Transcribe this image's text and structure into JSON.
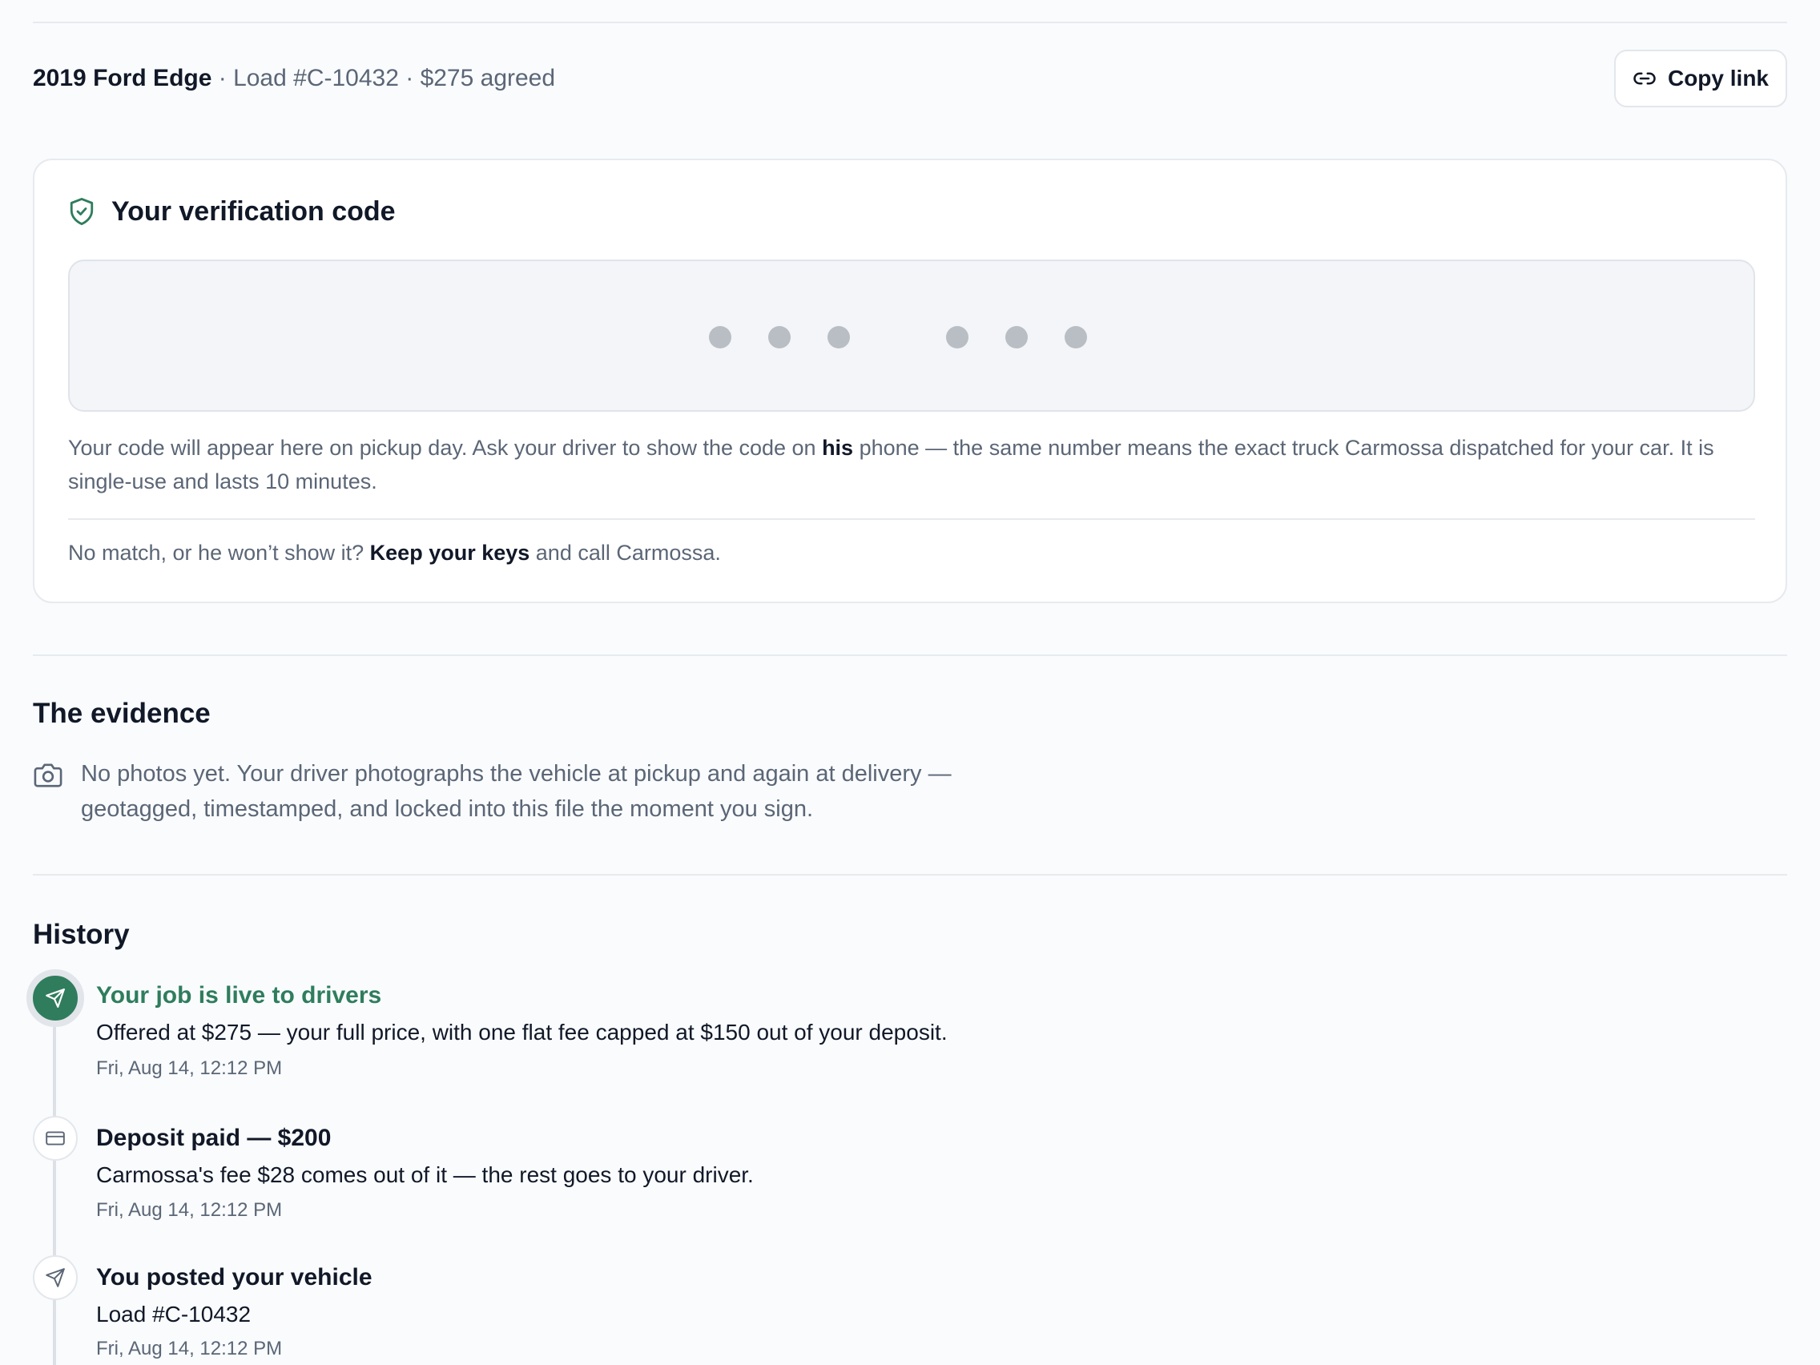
{
  "header": {
    "vehicle": "2019 Ford Edge",
    "meta": " · Load #C-10432 · $275 agreed",
    "copy_link_label": "Copy link"
  },
  "verification": {
    "title": "Your verification code",
    "code_placeholder_dots": 6,
    "desc_part1": "Your code will appear here on pickup day. Ask your driver to show the code on ",
    "desc_bold": "his",
    "desc_part2": " phone — the same number means the exact truck Carmossa dispatched for your car. It is single-use and lasts 10 minutes.",
    "warning_part1": "No match, or he won’t show it? ",
    "warning_bold": "Keep your keys",
    "warning_part2": " and call Carmossa."
  },
  "evidence": {
    "title": "The evidence",
    "text": "No photos yet. Your driver photographs the vehicle at pickup and again at delivery — geotagged, timestamped, and locked into this file the moment you sign."
  },
  "history": {
    "title": "History",
    "events": [
      {
        "title": "Your job is live to drivers",
        "desc": "Offered at $275 — your full price, with one flat fee capped at $150 out of your deposit.",
        "time": "Fri, Aug 14, 12:12 PM",
        "icon": "send-icon",
        "active": true
      },
      {
        "title": "Deposit paid — $200",
        "desc": "Carmossa's fee $28 comes out of it — the rest goes to your driver.",
        "time": "Fri, Aug 14, 12:12 PM",
        "icon": "credit-card-icon",
        "active": false
      },
      {
        "title": "You posted your vehicle",
        "desc": "Load #C-10432",
        "time": "Fri, Aug 14, 12:12 PM",
        "icon": "send-icon",
        "active": false
      }
    ]
  },
  "colors": {
    "accent_green": "#2f7d5d",
    "muted_text": "#5b6676",
    "border": "#e7eaee",
    "background": "#f9fbfd"
  }
}
